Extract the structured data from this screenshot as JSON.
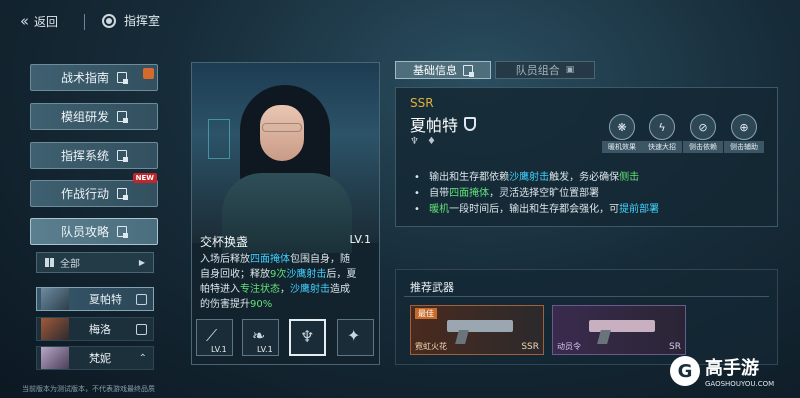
{
  "topbar": {
    "back_label": "返回",
    "room_label": "指挥室"
  },
  "menu": [
    {
      "label": "战术指南"
    },
    {
      "label": "模组研发"
    },
    {
      "label": "指挥系统"
    },
    {
      "label": "作战行动",
      "badge": "NEW"
    },
    {
      "label": "队员攻略"
    }
  ],
  "filter": {
    "label": "全部"
  },
  "members": [
    {
      "name": "夏帕特"
    },
    {
      "name": "梅洛"
    },
    {
      "name": "梵妮"
    }
  ],
  "footnote": "当前版本为测试版本，不代表游戏最终品质",
  "skill": {
    "name": "交杯换盏",
    "level": "LV.1",
    "desc_lines": [
      [
        "入场后释放",
        "四面掩体",
        "包围自身，随"
      ],
      [
        "自身回收；释放",
        "9次",
        "沙鹰射击",
        "后，夏"
      ],
      [
        "帕特进入",
        "专注状态",
        "，",
        "沙鹰射击",
        "造成"
      ],
      [
        "的伤害提升",
        "90%"
      ]
    ],
    "slot_levels": [
      "LV.1",
      "LV.1"
    ]
  },
  "tabs": {
    "info": "基础信息",
    "team": "队员组合"
  },
  "character": {
    "rarity": "SSR",
    "name": "夏帕特",
    "traits": [
      "暖机效果",
      "快速大招",
      "侧击依赖",
      "侧击辅助"
    ],
    "bullets": [
      [
        "输出和生存都依赖",
        "沙鹰射击",
        "触发，务必确保",
        "侧击"
      ],
      [
        "自带",
        "四面掩体",
        "，灵活选择空旷位置部署"
      ],
      [
        "暖机",
        "一段时间后，输出和生存都会强化，可",
        "提前部署"
      ]
    ]
  },
  "weapons": {
    "title": "推荐武器",
    "items": [
      {
        "tag": "最佳",
        "name": "霓虹火花",
        "grade": "SSR"
      },
      {
        "name": "动员令",
        "grade": "SR"
      }
    ]
  },
  "brand": {
    "name": "高手游",
    "url": "GAOSHOUYOU.COM"
  },
  "colors": {
    "highlight_cyan": "#3fd2ff",
    "highlight_green": "#62e07a",
    "rarity_gold": "#e0b13c"
  }
}
